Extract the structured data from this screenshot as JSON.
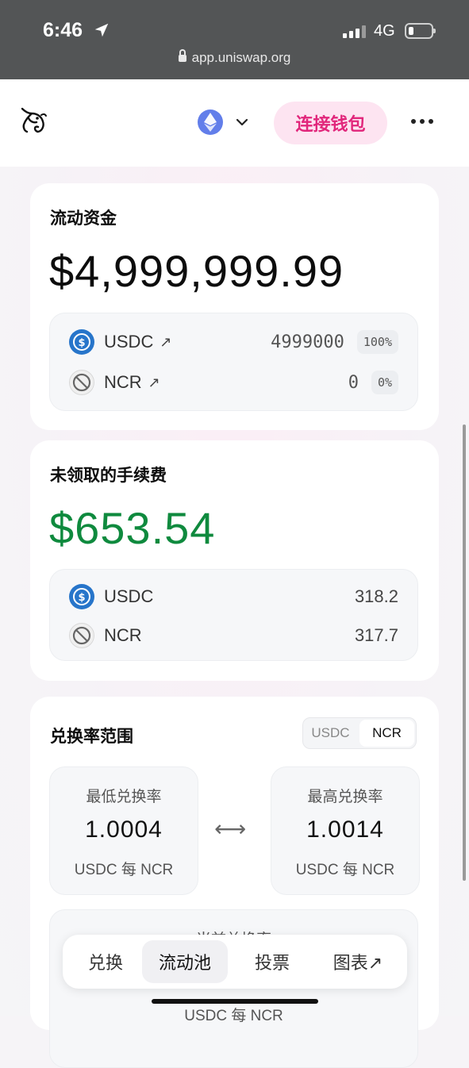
{
  "status_bar": {
    "time": "6:46",
    "network": "4G",
    "url": "app.uniswap.org"
  },
  "nav": {
    "connect_label": "连接钱包",
    "network_icon": "ethereum-icon"
  },
  "liquidity": {
    "title": "流动资金",
    "total": "$4,999,999.99",
    "tokens": [
      {
        "name": "USDC",
        "arrow": "↗",
        "amount": "4999000",
        "percent": "100%"
      },
      {
        "name": "NCR",
        "arrow": "↗",
        "amount": "0",
        "percent": "0%"
      }
    ]
  },
  "fees": {
    "title": "未领取的手续费",
    "total": "$653.54",
    "total_color": "#0f8a3e",
    "tokens": [
      {
        "name": "USDC",
        "amount": "318.2"
      },
      {
        "name": "NCR",
        "amount": "317.7"
      }
    ]
  },
  "range": {
    "title": "兑换率范围",
    "toggle": [
      "USDC",
      "NCR"
    ],
    "toggle_selected": "NCR",
    "min_label": "最低兑换率",
    "min_value": "1.0004",
    "min_unit": "USDC 每 NCR",
    "arrow": "⟷",
    "max_label": "最高兑换率",
    "max_value": "1.0014",
    "max_unit": "USDC 每 NCR",
    "current_label": "当前兑换率",
    "current_unit": "USDC 每 NCR"
  },
  "bottom_nav": {
    "items": [
      "兑换",
      "流动池",
      "投票",
      "图表↗"
    ],
    "active": "流动池"
  },
  "colors": {
    "accent_pink": "#e1267b",
    "accent_pink_bg": "#fde4f1",
    "usdc_blue": "#2775ca",
    "eth_purple": "#627eea"
  }
}
